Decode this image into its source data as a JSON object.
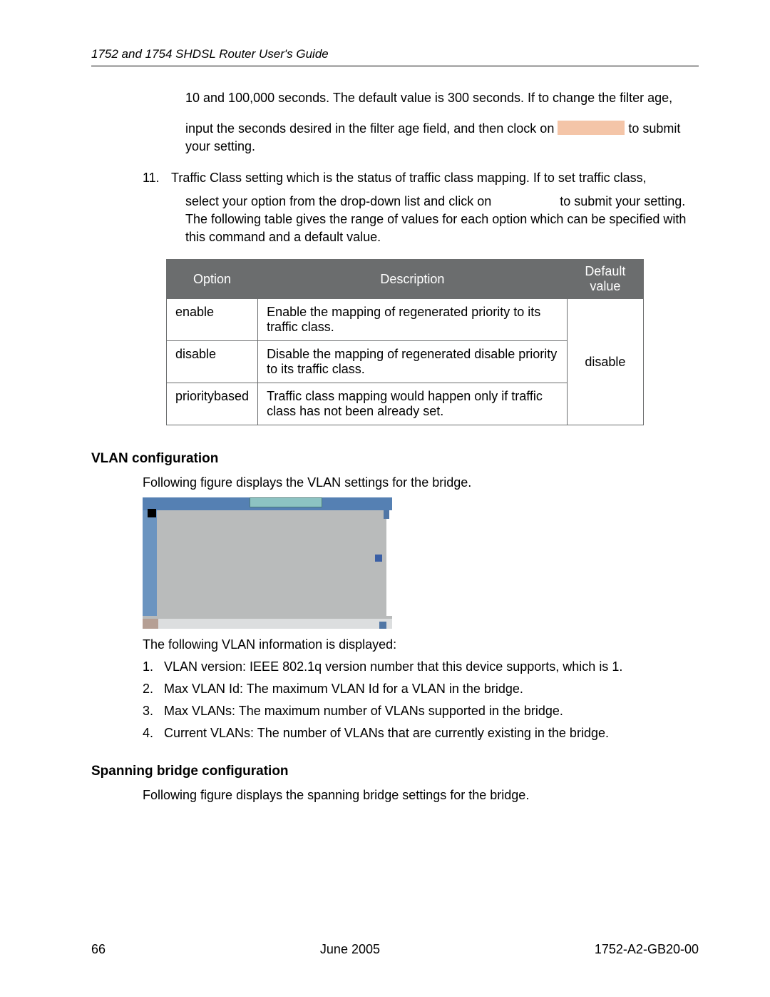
{
  "header": "1752 and 1754 SHDSL Router User's Guide",
  "para1a": "10 and 100,000 seconds. The default value is 300 seconds. If to change the filter age,",
  "para1b_pre": "input the seconds desired in the filter age field, and then clock on ",
  "para1b_post": " to submit your setting.",
  "item11_num": "11.",
  "item11_text": "Traffic Class setting which is the status of traffic class mapping. If to set traffic class,",
  "item11_sub_pre": "select your option from the drop-down list and click on ",
  "item11_sub_post": " to submit your setting. The following table gives the range of values for each option which can be specified with this command and a default value.",
  "table": {
    "headers": [
      "Option",
      "Description",
      "Default value"
    ],
    "rows": [
      {
        "option": "enable",
        "desc": "Enable the mapping of regenerated priority to its traffic class."
      },
      {
        "option": "disable",
        "desc": "Disable the mapping of regenerated disable priority to its traffic class."
      },
      {
        "option": "prioritybased",
        "desc": "Traffic class mapping would happen only if traffic class has not been already set."
      }
    ],
    "default": "disable"
  },
  "vlan_heading": "VLAN configuration",
  "vlan_intro": "Following figure displays the VLAN settings for the bridge.",
  "vlan_after": "The following VLAN information is displayed:",
  "vlan_list": [
    {
      "n": "1.",
      "t": "VLAN version: IEEE 802.1q version number that this device supports, which is 1."
    },
    {
      "n": "2.",
      "t": "Max VLAN Id: The maximum VLAN Id for a VLAN in the bridge."
    },
    {
      "n": "3.",
      "t": "Max VLANs: The maximum number of VLANs supported in the bridge."
    },
    {
      "n": "4.",
      "t": "Current VLANs: The number of VLANs that are currently existing in the bridge."
    }
  ],
  "span_heading": "Spanning bridge configuration",
  "span_intro": "Following figure displays the spanning bridge settings for the bridge.",
  "footer": {
    "page": "66",
    "date": "June 2005",
    "doc": "1752-A2-GB20-00"
  }
}
